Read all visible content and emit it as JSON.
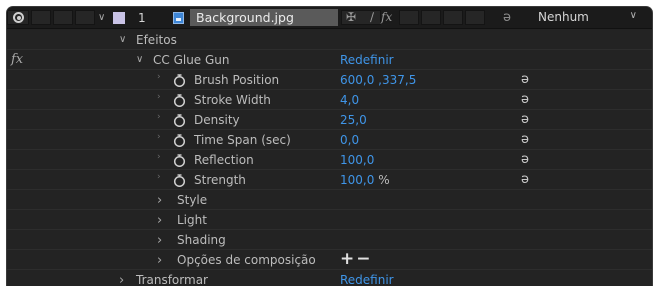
{
  "layer": {
    "number": "1",
    "name": "Background.jpg",
    "parent_value": "Nenhum",
    "label_color": "#c9c3e6"
  },
  "rows": {
    "effects": "Efeitos",
    "effect_name": "CC Glue Gun",
    "effect_reset": "Redefinir",
    "fx_badge": "fx",
    "transform": "Transformar",
    "transform_reset": "Redefinir"
  },
  "properties": [
    {
      "label": "Brush Position",
      "value": "600,0 ,337,5",
      "unit": ""
    },
    {
      "label": "Stroke Width",
      "value": "4,0",
      "unit": ""
    },
    {
      "label": "Density",
      "value": "25,0",
      "unit": ""
    },
    {
      "label": "Time Span (sec)",
      "value": "0,0",
      "unit": ""
    },
    {
      "label": "Reflection",
      "value": "100,0",
      "unit": ""
    },
    {
      "label": "Strength",
      "value": "100,0",
      "unit": "%"
    }
  ],
  "groups": [
    {
      "label": "Style"
    },
    {
      "label": "Light"
    },
    {
      "label": "Shading"
    },
    {
      "label": "Opções de composição",
      "controls": "+−"
    }
  ],
  "colors": {
    "value_blue": "#3f95e8",
    "panel_bg": "#232323"
  },
  "icons": [
    "eye-icon",
    "file-icon",
    "stopwatch-icon",
    "expression-spiral-icon",
    "chevron-down-icon",
    "chevron-right-icon"
  ]
}
